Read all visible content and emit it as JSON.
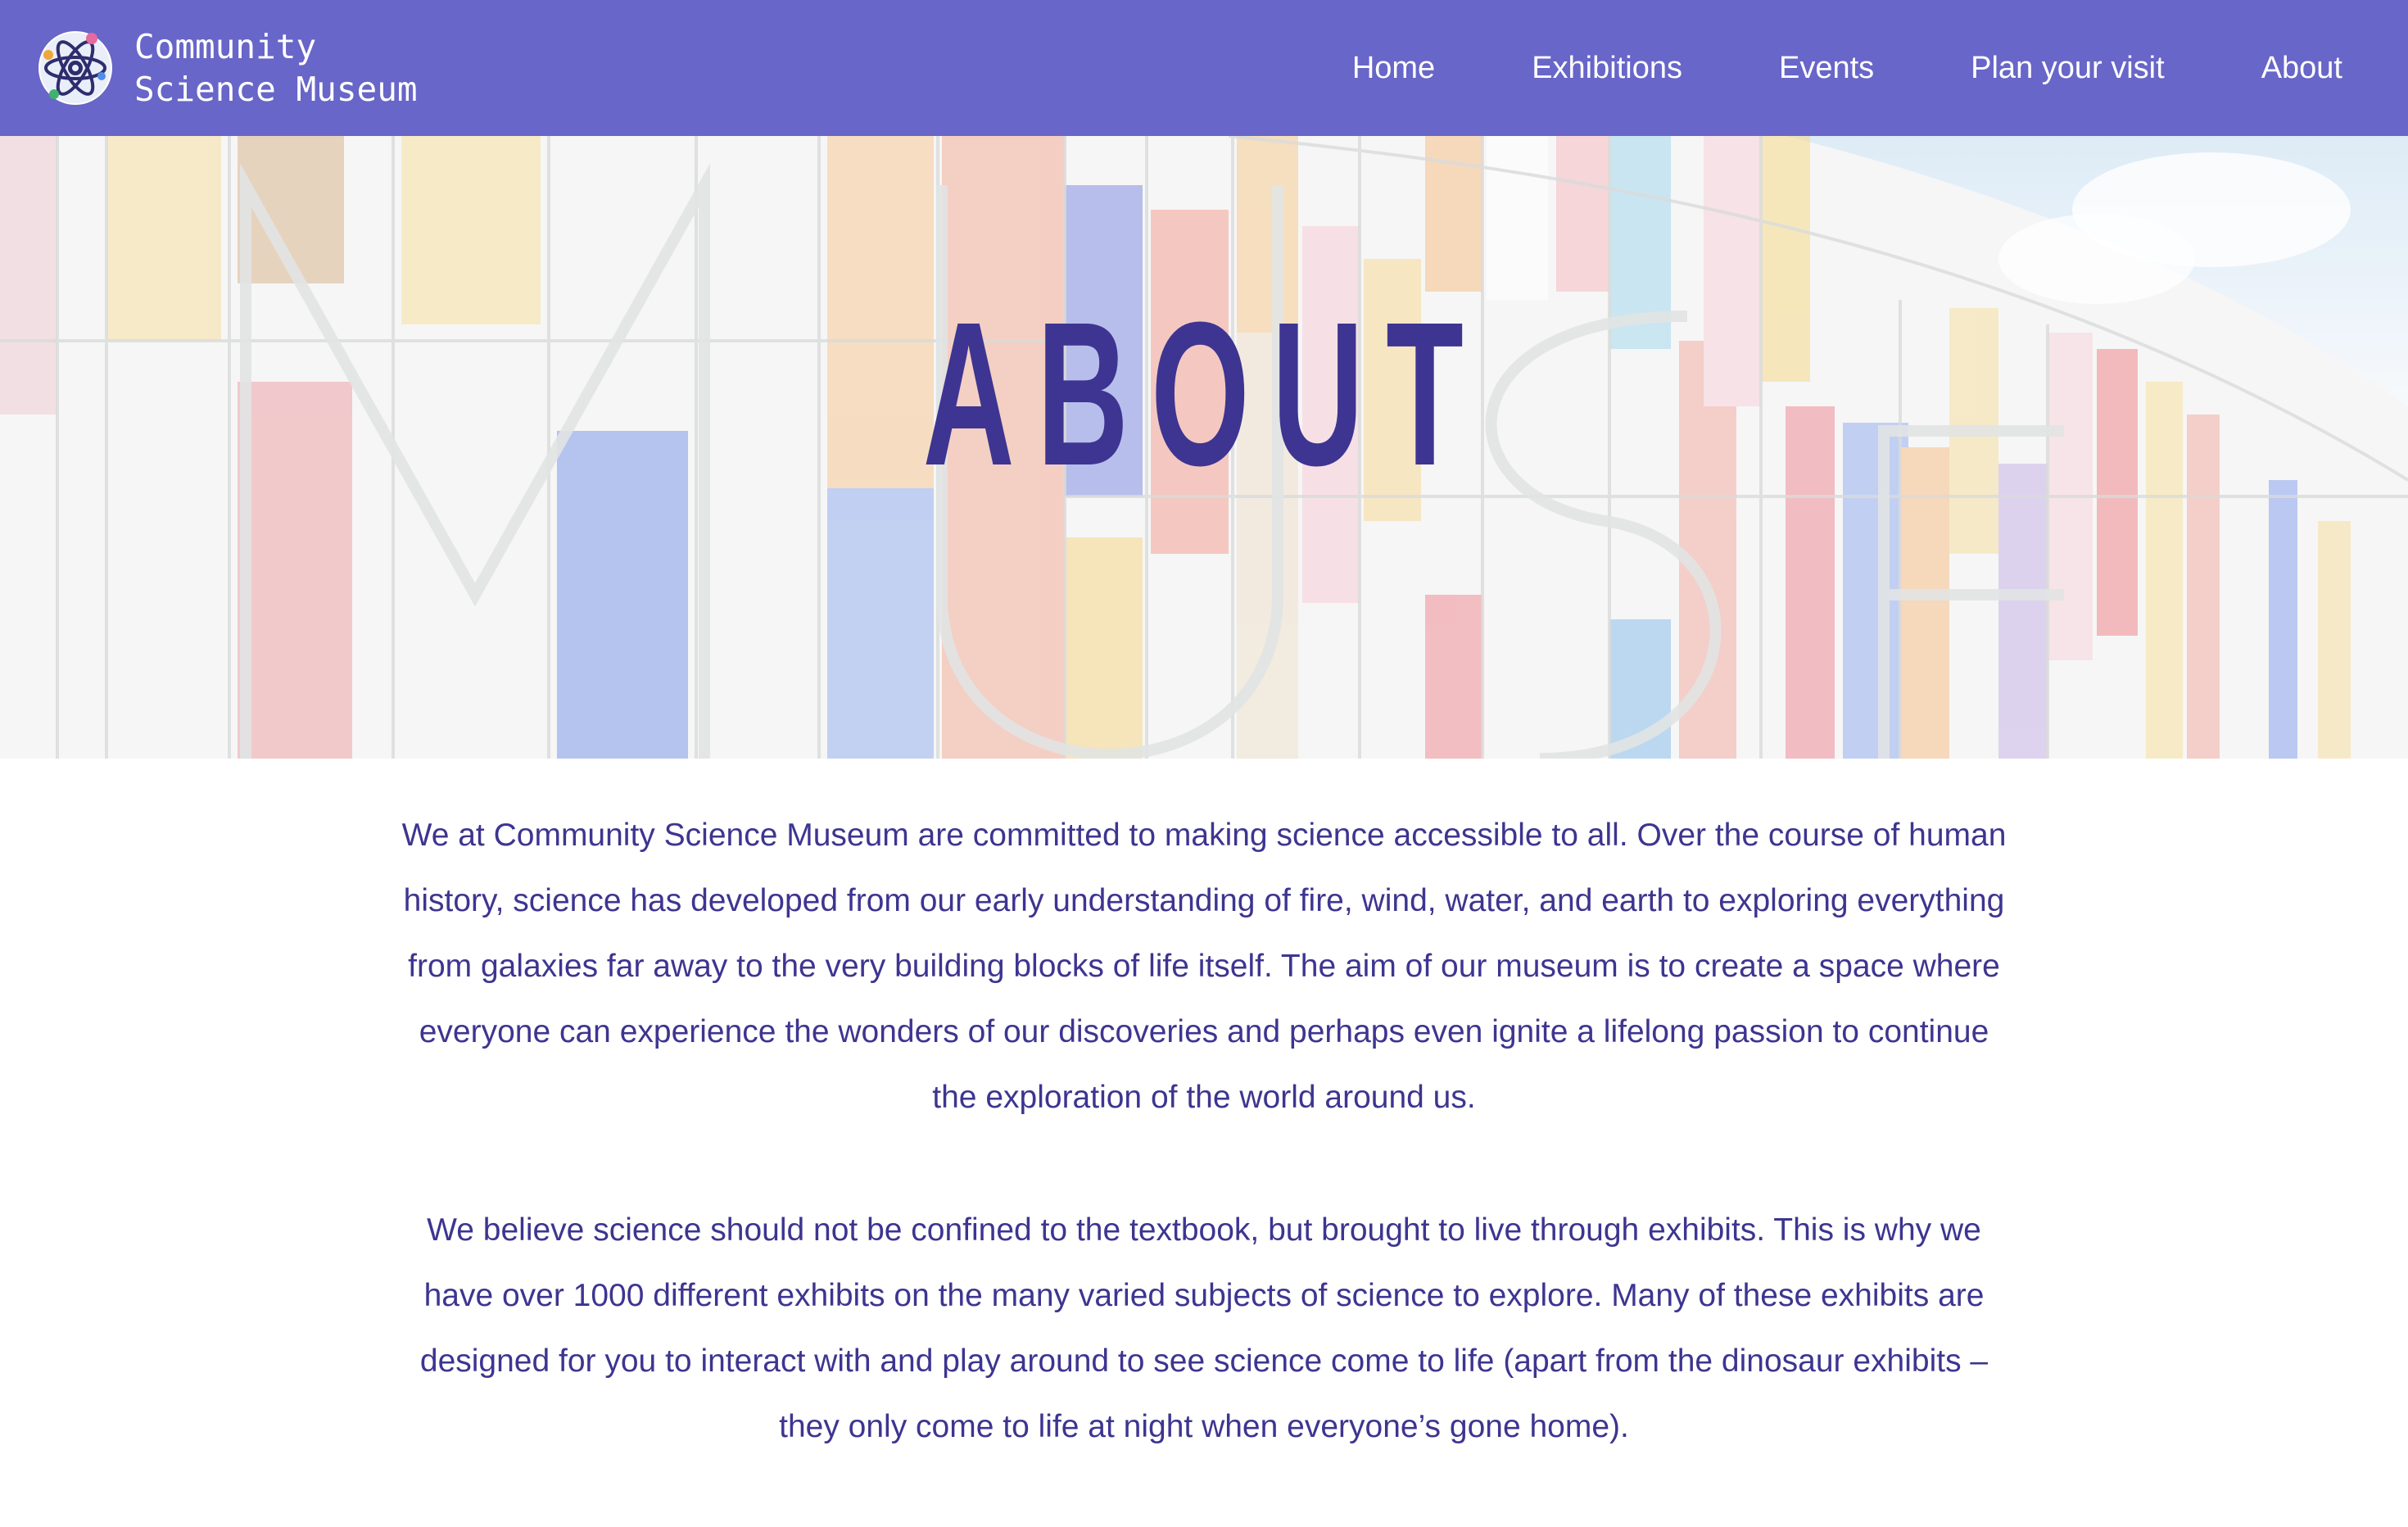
{
  "header": {
    "logo_icon": "atom-icon",
    "brand_line1": "Community",
    "brand_line2": "Science Museum",
    "background": "#6866c8",
    "nav": [
      {
        "label": "Home"
      },
      {
        "label": "Exhibitions"
      },
      {
        "label": "Events"
      },
      {
        "label": "Plan your visit"
      },
      {
        "label": "About"
      }
    ]
  },
  "hero": {
    "title": "ABOUT",
    "background_image": "colorful museum facade with large MUSEUM letters",
    "title_color": "#3d3591"
  },
  "content": {
    "paragraphs": [
      "We at Community Science Museum are committed to making science accessible to all. Over the course of human history, science has developed from our early understanding of fire, wind, water, and earth to exploring everything from galaxies far away to the very building blocks of life itself. The aim of our museum is to create a space where everyone can experience the wonders of our discoveries and perhaps even ignite a lifelong passion to continue the exploration of the world around us.",
      "We believe science should not be confined to the textbook, but brought to live through exhibits. This is why we have over 1000 different exhibits on the many varied subjects of science to explore. Many of these exhibits are designed for you to interact with and play around to see science come to life (apart from the dinosaur exhibits – they only come to life at night when everyone’s gone home)."
    ],
    "text_color": "#3d3590"
  }
}
